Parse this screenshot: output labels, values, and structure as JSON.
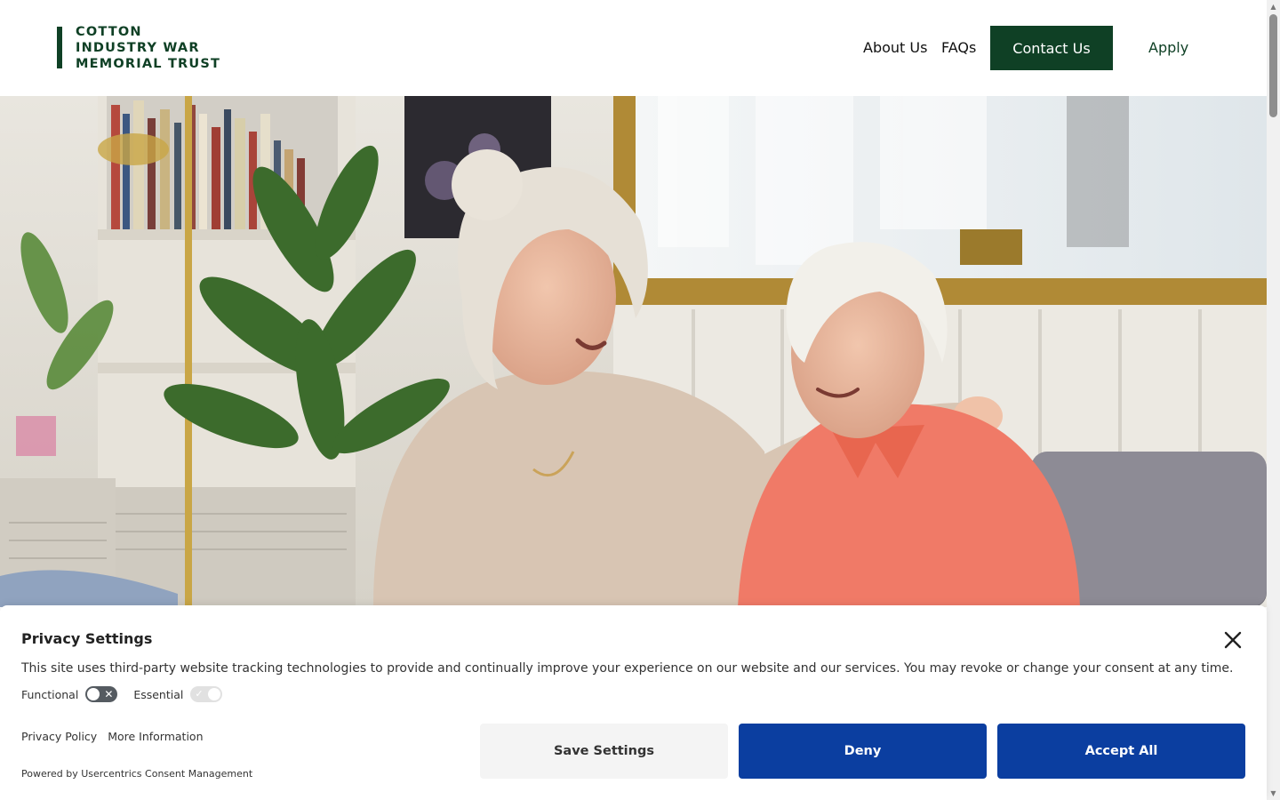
{
  "header": {
    "logo_lines": [
      "COTTON",
      "INDUSTRY WAR",
      "MEMORIAL TRUST"
    ],
    "nav": {
      "about": "About Us",
      "faqs": "FAQs",
      "contact": "Contact Us",
      "apply": "Apply"
    },
    "colors": {
      "brand_green": "#0f4025"
    }
  },
  "hero": {
    "image_subject": "two older women smiling together on a sofa"
  },
  "consent": {
    "title": "Privacy Settings",
    "description": "This site uses third-party website tracking technologies to provide and continually improve your experience on our website and our services. You may revoke or change your consent at any time.",
    "toggles": [
      {
        "label": "Functional",
        "state": "off"
      },
      {
        "label": "Essential",
        "state": "on",
        "disabled": true
      }
    ],
    "links": {
      "privacy_policy": "Privacy Policy",
      "more_info": "More Information"
    },
    "powered_by": "Powered by Usercentrics Consent Management",
    "buttons": {
      "save": "Save Settings",
      "deny": "Deny",
      "accept": "Accept All"
    },
    "colors": {
      "primary_button": "#0b3ea0"
    }
  }
}
